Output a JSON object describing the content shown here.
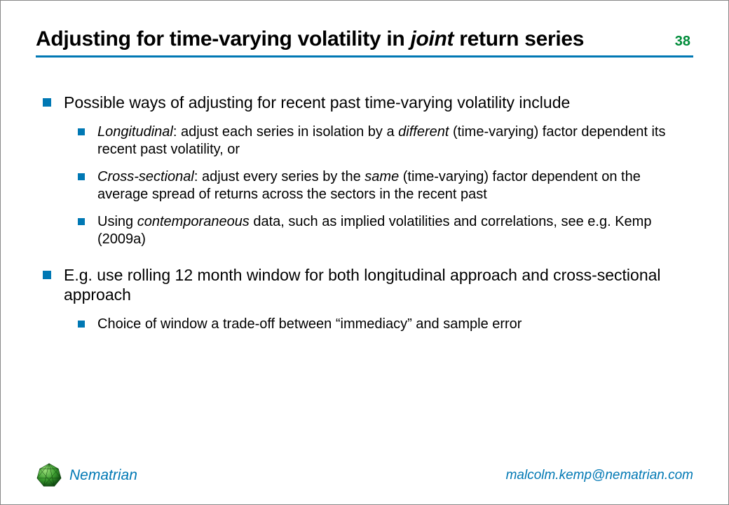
{
  "slide": {
    "title_pre": "Adjusting for time-varying volatility in ",
    "title_em": "joint",
    "title_post": " return series",
    "page_number": "38"
  },
  "bullets": {
    "b1": "Possible ways of adjusting for recent past time-varying volatility include",
    "b1_sub": {
      "s1_em": "Longitudinal",
      "s1_rest_a": ": adjust each series in isolation by a ",
      "s1_em2": "different",
      "s1_rest_b": " (time-varying) factor dependent its recent past volatility, or",
      "s2_em": "Cross-sectional",
      "s2_rest_a": ": adjust every series by the ",
      "s2_em2": "same",
      "s2_rest_b": " (time-varying) factor dependent on the average spread of returns across the sectors in the recent past",
      "s3_a": "Using ",
      "s3_em": "contemporaneous",
      "s3_b": " data, such as implied volatilities and correlations, see e.g. Kemp (2009a)"
    },
    "b2": "E.g. use rolling 12 month window for both longitudinal approach and cross-sectional approach",
    "b2_sub": {
      "s1": "Choice of window a trade-off between “immediacy” and sample error"
    }
  },
  "footer": {
    "brand": "Nematrian",
    "email": "malcolm.kemp@nematrian.com"
  },
  "colors": {
    "accent": "#0078b4",
    "page_number": "#008c3a"
  }
}
